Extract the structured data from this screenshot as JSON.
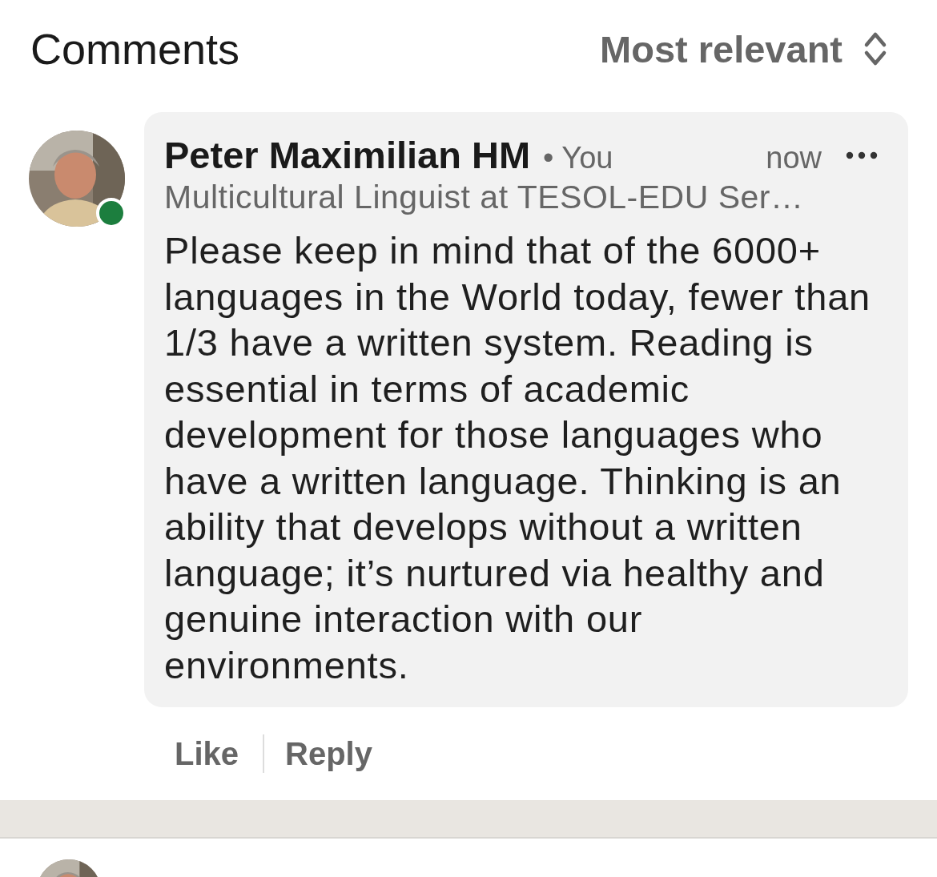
{
  "header": {
    "title": "Comments",
    "sort": "Most relevant"
  },
  "comments": [
    {
      "author": "Peter Maximilian HM",
      "badge": "• You",
      "time": "now",
      "headline": "Multicultural Linguist at TESOL-EDU Ser…",
      "online": true,
      "body": "Please keep in mind that of the 6000+ languages in the World today, fewer than 1/3 have a written system. Reading is essential in terms of academic development for those languages who have a written language. Thinking is an ability that develops without a written language; it’s nurtured via healthy and genuine interaction with our environments.",
      "actions": [
        "Like",
        "Reply"
      ]
    }
  ]
}
